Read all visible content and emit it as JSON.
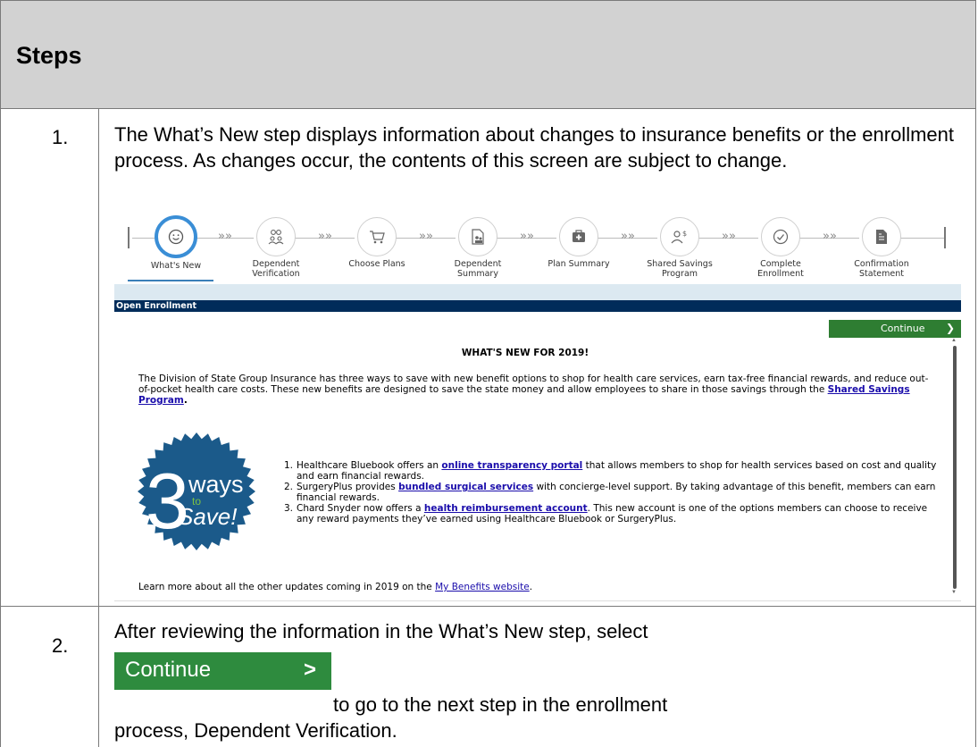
{
  "header": {
    "title": "Steps"
  },
  "steps": [
    {
      "number": "1.",
      "text": "The What’s New step displays information about changes to insurance benefits or the enrollment process.  As changes occur, the contents of this screen are subject to change."
    },
    {
      "number": "2.",
      "text_before": "After reviewing the information in the What’s New step, select",
      "button_label": "Continue",
      "text_after": "to go to the next step in the enrollment process, Dependent Verification."
    }
  ],
  "screenshot": {
    "wizard_steps": [
      {
        "label": "What's New",
        "icon": "smiley-icon",
        "active": true
      },
      {
        "label": "Dependent Verification",
        "icon": "people-icon",
        "active": false
      },
      {
        "label": "Choose Plans",
        "icon": "cart-icon",
        "active": false
      },
      {
        "label": "Dependent Summary",
        "icon": "document-people-icon",
        "active": false
      },
      {
        "label": "Plan Summary",
        "icon": "medical-bag-icon",
        "active": false
      },
      {
        "label": "Shared Savings Program",
        "icon": "person-dollar-icon",
        "active": false
      },
      {
        "label": "Complete Enrollment",
        "icon": "check-circle-icon",
        "active": false
      },
      {
        "label": "Confirmation Statement",
        "icon": "file-icon",
        "active": false
      }
    ],
    "section_label": "Open Enrollment",
    "continue_label": "Continue",
    "content_title": "WHAT'S NEW FOR 2019!",
    "intro_text": "The Division of State Group Insurance has three ways to save with new benefit options to shop for health care services, earn tax-free financial rewards, and reduce out-of-pocket health care costs. These new benefits are designed to save the state money and allow employees to share in those savings through the",
    "intro_link": "Shared Savings Program",
    "seal": {
      "big": "3",
      "ways": "ways",
      "to": "to",
      "save": "Save!",
      "color": "#1b5a8a"
    },
    "list": [
      {
        "n": "1.",
        "pre": "Healthcare Bluebook offers an",
        "link": "online transparency portal",
        "post": "that allows members to shop for health services based on cost and quality and earn financial rewards."
      },
      {
        "n": "2.",
        "pre": "SurgeryPlus provides",
        "link": "bundled surgical services",
        "post": "with concierge-level support. By taking advantage of this benefit, members can earn financial rewards."
      },
      {
        "n": "3.",
        "pre": "Chard Snyder now offers a",
        "link": "health reimbursement account",
        "post": ". This new account is one of the options members can choose to receive any reward payments they’ve earned using Healthcare Bluebook or SurgeryPlus."
      }
    ],
    "learn_more_pre": "Learn more about all the other updates coming in 2019 on the",
    "learn_more_link": "My Benefits website",
    "learn_more_post": "."
  },
  "colors": {
    "accent_green": "#2e7d32",
    "navy": "#002c5a",
    "active_blue": "#3a8ed6",
    "link": "#1a0dab"
  }
}
